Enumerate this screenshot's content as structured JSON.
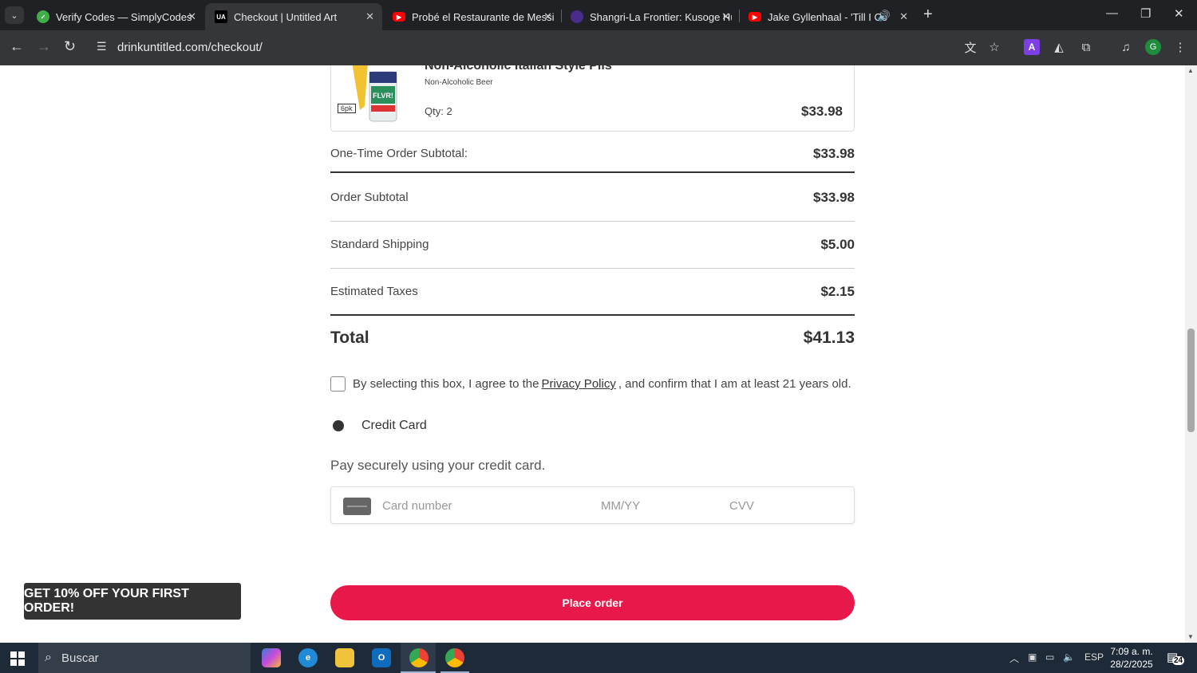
{
  "browser": {
    "tabs": [
      {
        "title": "Verify Codes — SimplyCodes",
        "favicon_color": "#3fae49"
      },
      {
        "title": "Checkout | Untitled Art",
        "favicon_text": "UA",
        "favicon_color": "#000000"
      },
      {
        "title": "Probé el Restaurante de Messi e",
        "favicon_color": "#ff0000"
      },
      {
        "title": "Shangri-La Frontier: Kusoge Hu",
        "favicon_color": "#4a2c8a"
      },
      {
        "title": "Jake Gyllenhaal - 'Till I Colla",
        "favicon_color": "#ff0000"
      }
    ],
    "url": "drinkuntitled.com/checkout/"
  },
  "product": {
    "name": "Non-Alcoholic Italian Style Pils",
    "subtitle": "Non-Alcoholic Beer",
    "qty": "Qty: 2",
    "price": "$33.98",
    "pack_label": "6pk",
    "can_brand": "FLVR!"
  },
  "summary": {
    "one_time_label": "One-Time Order Subtotal:",
    "one_time_value": "$33.98",
    "order_subtotal_label": "Order Subtotal",
    "order_subtotal_value": "$33.98",
    "shipping_label": "Standard Shipping",
    "shipping_value": "$5.00",
    "taxes_label": "Estimated Taxes",
    "taxes_value": "$2.15",
    "total_label": "Total",
    "total_value": "$41.13"
  },
  "agreement": {
    "before": "By selecting this box, I agree to the",
    "link": "Privacy Policy",
    "after": ", and confirm that I am at least 21 years old."
  },
  "payment": {
    "method": "Credit Card",
    "description": "Pay securely using your credit card.",
    "card_number_placeholder": "Card number",
    "expiry_placeholder": "MM/YY",
    "cvv_placeholder": "CVV"
  },
  "promo_banner": "GET 10% OFF YOUR FIRST ORDER!",
  "place_order": "Place order",
  "taskbar": {
    "search": "Buscar",
    "lang": "ESP",
    "time": "7:09 a. m.",
    "date": "28/2/2025",
    "notifications": "24"
  },
  "colors": {
    "accent": "#e8184b",
    "tabbar": "#202124",
    "taskbar": "#1f2a38"
  }
}
